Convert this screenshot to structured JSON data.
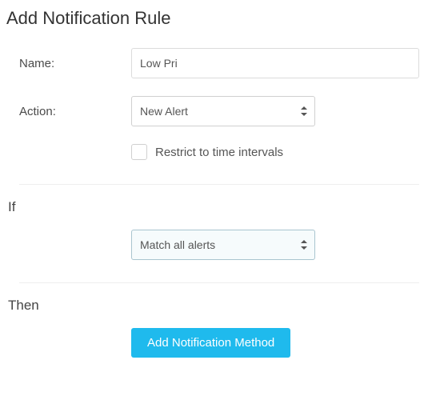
{
  "title": "Add Notification Rule",
  "labels": {
    "name": "Name:",
    "action": "Action:",
    "restrict": "Restrict to time intervals",
    "if": "If",
    "then": "Then"
  },
  "fields": {
    "name_value": "Low Pri",
    "action_value": "New Alert",
    "if_condition": "Match all alerts"
  },
  "buttons": {
    "add_method": "Add Notification Method"
  }
}
